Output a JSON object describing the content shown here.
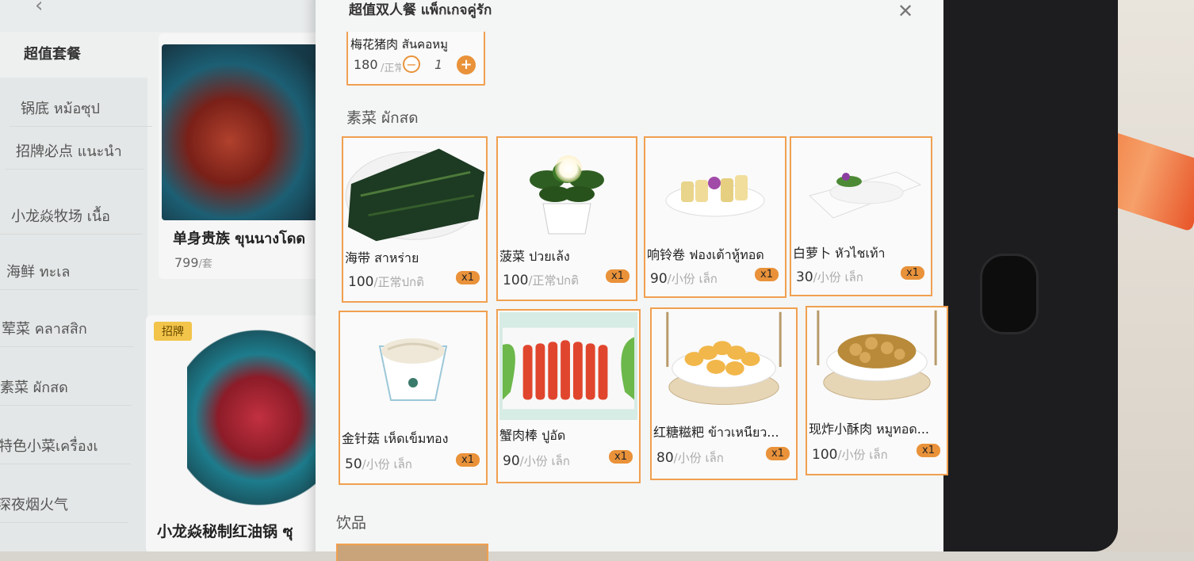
{
  "background": {
    "section_title": "超值套餐",
    "categories": [
      {
        "label": "锅底 หม้อซุป"
      },
      {
        "label": "招牌必点 แนะนำ"
      },
      {
        "label": "小龙焱牧场 เนื้อ"
      },
      {
        "label": "海鲜 ทะเล"
      },
      {
        "label": "荤菜 คลาสสิก"
      },
      {
        "label": "素菜 ผักสด"
      },
      {
        "label": "特色小菜เครื่องเ"
      },
      {
        "label": "深夜烟火气"
      }
    ],
    "dish1": {
      "name": "单身贵族 ขุนนางโดด",
      "price": "799",
      "unit": "/套"
    },
    "badge": "招牌",
    "dish2": {
      "name": "小龙焱秘制红油锅 ซุ"
    }
  },
  "modal": {
    "title": "超值双人餐 แพ็กเกจคู่รัก",
    "top_item": {
      "name": "梅花猪肉 สันคอหมู",
      "price": "180",
      "unit": "/正常",
      "qty": "1"
    },
    "section_vegetables": "素菜 ผักสด",
    "section_drinks": "饮品",
    "items": [
      {
        "name": "海带 สาหร่าย",
        "price": "100",
        "unit": "/正常ปกติ",
        "badge": "x1",
        "icon": "kelp-photo"
      },
      {
        "name": "菠菜 ปวยเล้ง",
        "price": "100",
        "unit": "/正常ปกติ",
        "badge": "x1",
        "icon": "spinach-photo"
      },
      {
        "name": "响铃卷 ฟองเต้าหู้ทอด",
        "price": "90",
        "unit": "/小份 เล็ก",
        "badge": "x1",
        "icon": "tofu-skin-roll-photo"
      },
      {
        "name": "白萝卜 หัวไชเท้า",
        "price": "30",
        "unit": "/小份 เล็ก",
        "badge": "x1",
        "icon": "radish-photo"
      },
      {
        "name": "金针菇 เห็ดเข็มทอง",
        "price": "50",
        "unit": "/小份 เล็ก",
        "badge": "x1",
        "icon": "enoki-photo"
      },
      {
        "name": "蟹肉棒 ปูอัด",
        "price": "90",
        "unit": "/小份 เล็ก",
        "badge": "x1",
        "icon": "crab-stick-photo"
      },
      {
        "name": "红糖糍粑 ข้าวเหนียว...",
        "price": "80",
        "unit": "/小份 เล็ก",
        "badge": "x1",
        "icon": "rice-cake-photo"
      },
      {
        "name": "现炸小酥肉 หมูทอด...",
        "price": "100",
        "unit": "/小份 เล็ก",
        "badge": "x1",
        "icon": "fried-pork-photo"
      }
    ]
  },
  "colors": {
    "accent": "#e9923a",
    "border": "#f0a050"
  }
}
